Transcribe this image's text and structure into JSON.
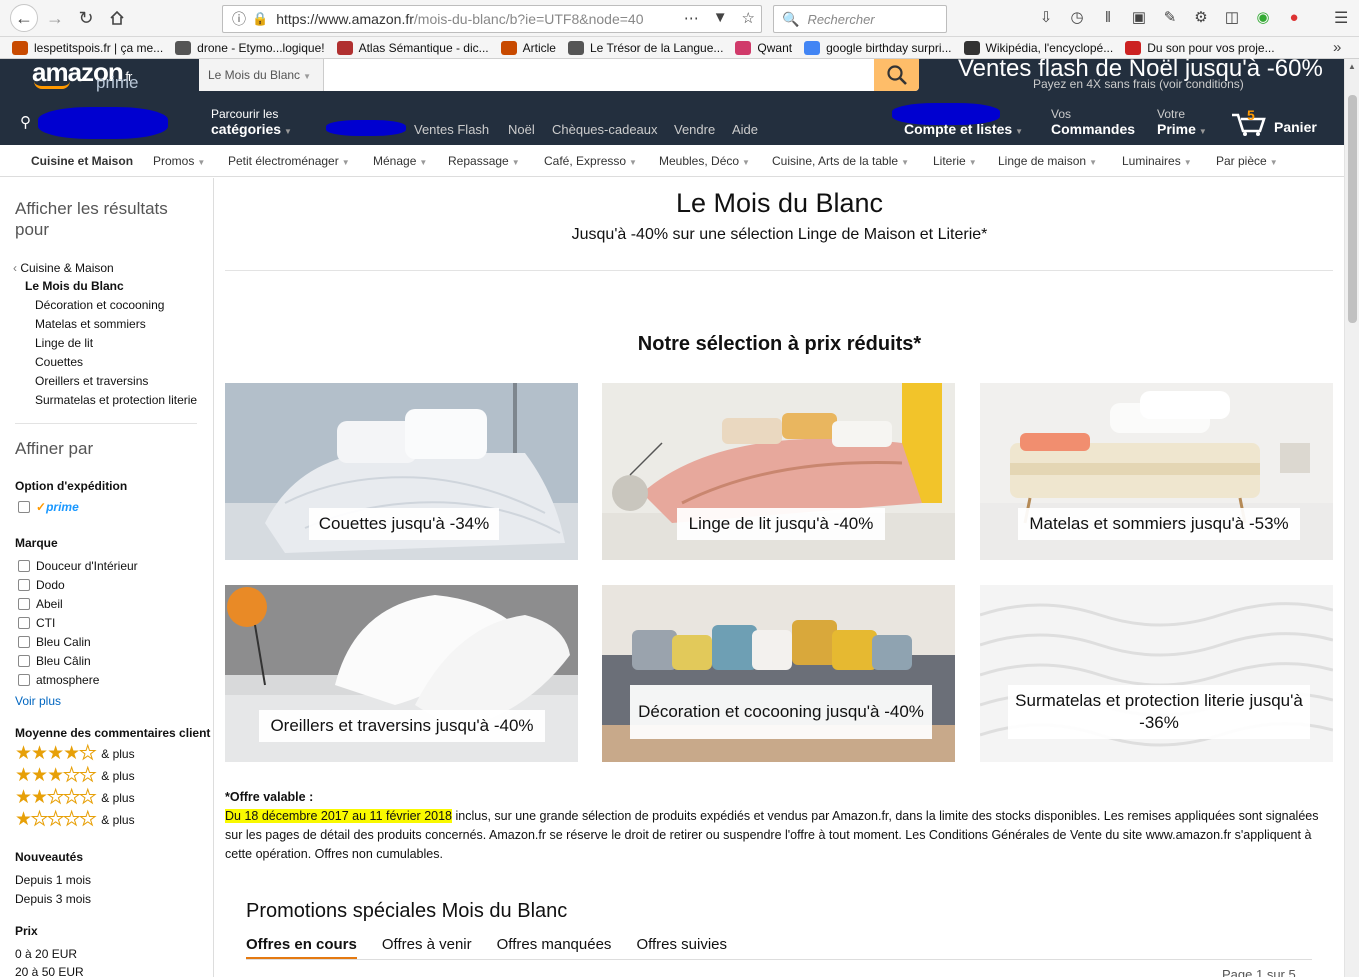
{
  "browser": {
    "url_host": "https://www.amazon.fr",
    "url_path": "/mois-du-blanc/b?ie=UTF8&node=40",
    "search_placeholder": "Rechercher",
    "bookmarks": [
      {
        "label": "lespetitspois.fr | ça me...",
        "icon": "ipe-icon",
        "color": "#c84a00"
      },
      {
        "label": "drone - Etymo...logique!",
        "icon": "globe-icon",
        "color": "#555555"
      },
      {
        "label": "Atlas Sémantique - dic...",
        "icon": "atlas-icon",
        "color": "#b03030"
      },
      {
        "label": "Article",
        "icon": "ipe-icon",
        "color": "#c84a00"
      },
      {
        "label": "Le Trésor de la Langue...",
        "icon": "globe-icon",
        "color": "#555555"
      },
      {
        "label": "Qwant",
        "icon": "qwant-icon",
        "color": "#d03a6a"
      },
      {
        "label": "google birthday surpri...",
        "icon": "google-icon",
        "color": "#4285f4"
      },
      {
        "label": "Wikipédia, l'encyclopé...",
        "icon": "wikipedia-icon",
        "color": "#333333"
      },
      {
        "label": "Du son pour vos proje...",
        "icon": "sound-icon",
        "color": "#cc2222"
      }
    ]
  },
  "amazon": {
    "logo_text": "amazon",
    "logo_tld": ".fr",
    "logo_prime": "prime",
    "search_dept": "Le Mois du Blanc",
    "flash_title": "Ventes flash de Noël jusqu'à -60%",
    "flash_sub": "Payez en 4X sans frais  (voir conditions)",
    "nav": {
      "browse_small": "Parcourir les",
      "browse_big": "catégories",
      "links": [
        "Ventes Flash",
        "Noël",
        "Chèques-cadeaux",
        "Vendre",
        "Aide"
      ],
      "account_big": "Compte et listes",
      "orders_small": "Vos",
      "orders_big": "Commandes",
      "prime_small": "Votre",
      "prime_big": "Prime",
      "cart_count": "5",
      "cart_label": "Panier"
    },
    "subnav": [
      "Cuisine et Maison",
      "Promos",
      "Petit électroménager",
      "Ménage",
      "Repassage",
      "Café, Expresso",
      "Meubles, Déco",
      "Cuisine, Arts de la table",
      "Literie",
      "Linge de maison",
      "Luminaires",
      "Par pièce"
    ]
  },
  "sidebar": {
    "results_title": "Afficher les résultats pour",
    "parent_cat": "Cuisine & Maison",
    "current_cat": "Le Mois du Blanc",
    "sub_cats": [
      "Décoration et cocooning",
      "Matelas et sommiers",
      "Linge de lit",
      "Couettes",
      "Oreillers et traversins",
      "Surmatelas et protection literie"
    ],
    "refine_title": "Affiner par",
    "shipping_title": "Option d'expédition",
    "prime_label": "prime",
    "brand_title": "Marque",
    "brands": [
      "Douceur d'Intérieur",
      "Dodo",
      "Abeil",
      "CTI",
      "Bleu Calin",
      "Bleu Câlin",
      "atmosphere"
    ],
    "see_more": "Voir plus",
    "reviews_title": "Moyenne des commentaires client",
    "review_rows": [
      {
        "stars": 4,
        "label": "& plus"
      },
      {
        "stars": 3,
        "label": "& plus"
      },
      {
        "stars": 2,
        "label": "& plus"
      },
      {
        "stars": 1,
        "label": "& plus"
      }
    ],
    "new_title": "Nouveautés",
    "new_items": [
      "Depuis 1 mois",
      "Depuis 3 mois"
    ],
    "price_title": "Prix",
    "price_items": [
      "0 à 20 EUR",
      "20 à 50 EUR"
    ]
  },
  "main": {
    "title": "Le Mois du Blanc",
    "subtitle": "Jusqu'à -40% sur une sélection Linge de Maison et Literie*",
    "selection_title": "Notre sélection à prix réduits*",
    "tiles": [
      {
        "label": "Couettes jusqu'à -34%"
      },
      {
        "label": "Linge de lit jusqu'à -40%"
      },
      {
        "label": "Matelas et sommiers jusqu'à -53%"
      },
      {
        "label": "Oreillers et traversins jusqu'à -40%"
      },
      {
        "label": "Décoration et cocooning jusqu'à -40%"
      },
      {
        "label": "Surmatelas et protection literie jusqu'à -36%"
      }
    ],
    "offer_title": "*Offre valable :",
    "offer_dates": "Du 18 décembre 2017 au 11 février 2018",
    "offer_text": " inclus, sur une grande sélection de produits expédiés et vendus par Amazon.fr, dans la limite des stocks disponibles. Les remises appliquées sont signalées sur les pages de détail des produits concernés. Amazon.fr se réserve le droit de retirer ou suspendre l'offre à tout moment. Les Conditions Générales de Vente du site www.amazon.fr s'appliquent à cette opération. Offres non cumulables.",
    "promo_title": "Promotions spéciales Mois du Blanc",
    "promo_tabs": [
      "Offres en cours",
      "Offres à venir",
      "Offres manquées",
      "Offres suivies"
    ],
    "page_count": "Page 1 sur 5"
  }
}
